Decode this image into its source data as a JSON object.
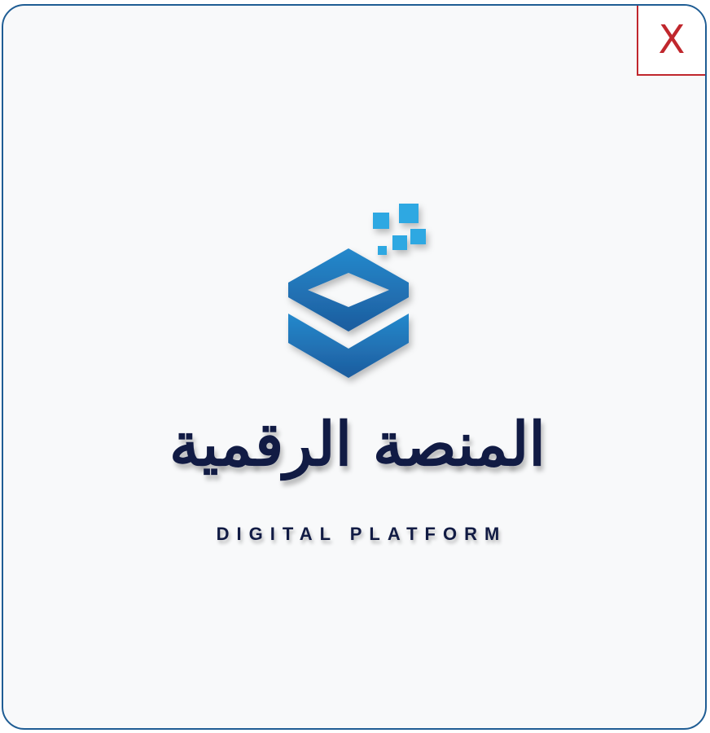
{
  "dialog": {
    "close_label": "X"
  },
  "logo": {
    "name_ar": "المنصة الرقمية",
    "name_en": "DIGITAL PLATFORM",
    "colors": {
      "brand_blue": "#1f7fc4",
      "brand_blue_dark": "#1d5c9e",
      "pixel_blue": "#2fa8e2",
      "text_navy": "#111b44",
      "close_red": "#c0272d"
    }
  }
}
